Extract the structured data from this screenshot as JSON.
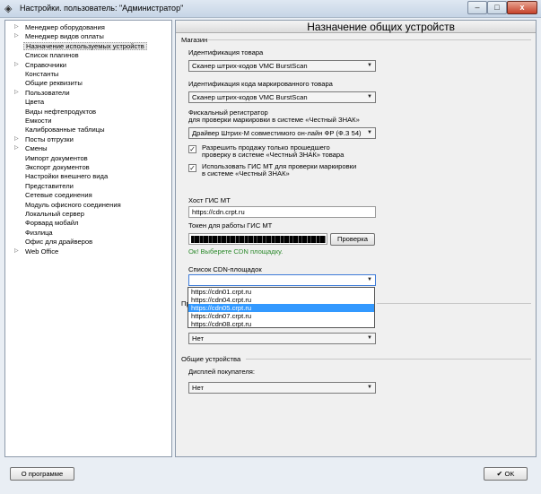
{
  "window": {
    "title": "Настройки. пользователь: \"Администратор\"",
    "controls": {
      "minimize": "–",
      "maximize": "□",
      "close": "x"
    }
  },
  "sidebar": {
    "items": [
      {
        "label": "Менеджер оборудования",
        "expandable": true
      },
      {
        "label": "Менеджер видов оплаты",
        "expandable": true
      },
      {
        "label": "Назначение используемых устройств",
        "expandable": false,
        "selected": true
      },
      {
        "label": "Список плагинов",
        "expandable": false
      },
      {
        "label": "Справочники",
        "expandable": true
      },
      {
        "label": "Константы",
        "expandable": false
      },
      {
        "label": "Общие реквизиты",
        "expandable": false
      },
      {
        "label": "Пользователи",
        "expandable": true
      },
      {
        "label": "Цвета",
        "expandable": false
      },
      {
        "label": "Виды нефтепродуктов",
        "expandable": false
      },
      {
        "label": "Емкости",
        "expandable": false
      },
      {
        "label": "Калиброванные таблицы",
        "expandable": false
      },
      {
        "label": "Посты отгрузки",
        "expandable": true
      },
      {
        "label": "Смены",
        "expandable": true
      },
      {
        "label": "Импорт документов",
        "expandable": false
      },
      {
        "label": "Экспорт документов",
        "expandable": false
      },
      {
        "label": "Настройки внешнего вида",
        "expandable": false
      },
      {
        "label": "Представители",
        "expandable": false
      },
      {
        "label": "Сетевые соединения",
        "expandable": false
      },
      {
        "label": "Модуль офисного соединения",
        "expandable": false
      },
      {
        "label": "Локальный сервер",
        "expandable": false
      },
      {
        "label": "Форвард мобайл",
        "expandable": false
      },
      {
        "label": "Физлица",
        "expandable": false
      },
      {
        "label": "Офис для драйверов",
        "expandable": false
      },
      {
        "label": "Web Office",
        "expandable": true
      }
    ]
  },
  "page": {
    "title": "Назначение общих устройств",
    "shop_group": {
      "title": "Магазин",
      "product_id_label": "Идентификация товара",
      "product_id_value": "Сканер штрих-кодов VMC BurstScan",
      "marked_id_label": "Идентификация кода маркированного товара",
      "marked_id_value": "Сканер штрих-кодов VMC BurstScan",
      "fiscal_label_line1": "Фискальный регистратор",
      "fiscal_label_line2": "для проверки маркировки в системе «Честный ЗНАК»",
      "fiscal_value": "Драйвер Штрих-М совместимого он-лайн ФР (Ф.З 54)",
      "checkbox1_line1": "Разрешить продажу только прошедшего",
      "checkbox1_line2": "проверку в системе «Честный ЗНАК» товара",
      "checkbox2_line1": "Использовать ГИС МТ для проверки маркировки",
      "checkbox2_line2": "в системе «Честный ЗНАК»",
      "host_label": "Хост ГИС МТ",
      "host_value": "https://cdn.crpt.ru",
      "token_label": "Токен для работы ГИС МТ",
      "check_button": "Проверка",
      "status_text": "Ок! Выберете CDN площадку.",
      "cdn_label": "Список CDN-площадок",
      "cdn_options": [
        "https://cdn01.crpt.ru",
        "https://cdn04.crpt.ru",
        "https://cdn05.crpt.ru",
        "https://cdn07.crpt.ru",
        "https://cdn08.crpt.ru"
      ],
      "cdn_selected_index": 2
    },
    "hidden_group": {
      "title_fragment": "Пр",
      "value": "Нет"
    },
    "common_group": {
      "title": "Общие устройства",
      "display_label": "Дисплей покупателя:",
      "display_value": "Нет"
    }
  },
  "footer": {
    "about_button": "О программе",
    "ok_button": "OK"
  },
  "colors": {
    "selection": "#3399ff",
    "ok_status": "#2c8a2c",
    "focus_border": "#3d7bd8"
  }
}
